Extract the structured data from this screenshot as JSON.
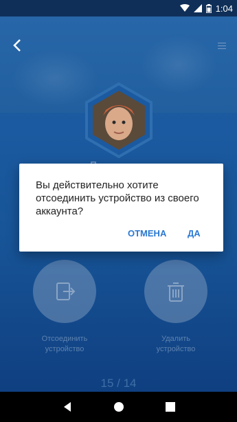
{
  "status_bar": {
    "time": "1:04",
    "icons": [
      "wifi-icon",
      "signal-icon",
      "battery-icon"
    ]
  },
  "header": {
    "back_icon": "back-arrow-icon",
    "menu_icon": "menu-icon"
  },
  "profile": {
    "name": "Лененька"
  },
  "actions": [
    {
      "label": "Отсоединить\nустройство",
      "icon": "disconnect-icon"
    },
    {
      "label": "Удалить\nустройство",
      "icon": "trash-icon"
    }
  ],
  "pager": "15 / 14",
  "dialog": {
    "message": "Вы действительно хотите отсоединить устройство из своего аккаунта?",
    "cancel_label": "ОТМЕНА",
    "ok_label": "ДА"
  },
  "colors": {
    "accent": "#2a78d0",
    "background": "#1b5aa0"
  }
}
